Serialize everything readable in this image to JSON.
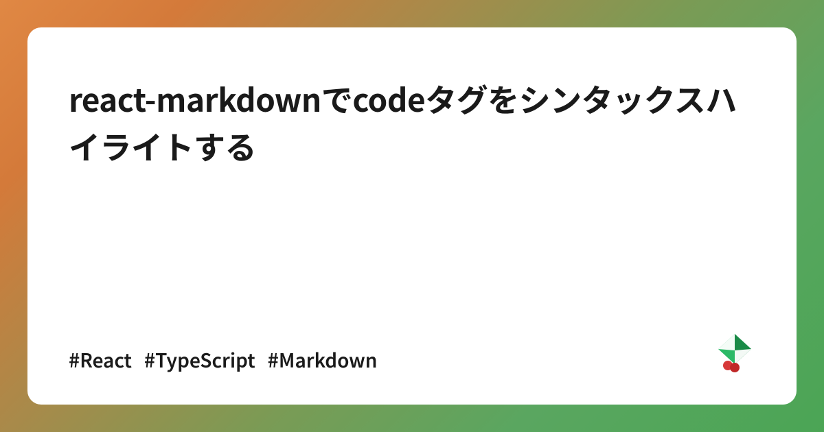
{
  "card": {
    "title": "react-markdownでcodeタグをシンタックスハイライトする",
    "tags": [
      "#React",
      "#TypeScript",
      "#Markdown"
    ]
  }
}
